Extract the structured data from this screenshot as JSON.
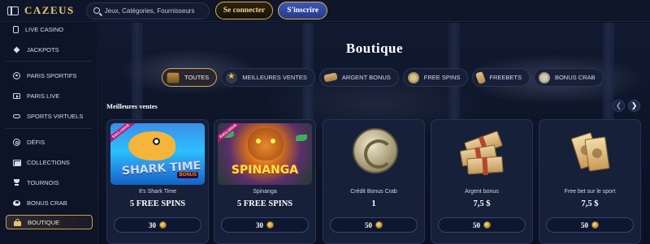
{
  "header": {
    "logo": "CAZEUS",
    "search_placeholder": "Jeux, Catégories, Fournisseurs",
    "login_label": "Se connecter",
    "signup_label": "S'inscrire"
  },
  "sidebar": {
    "items": [
      {
        "label": "LIVE CASINO",
        "icon": "tablet-icon"
      },
      {
        "label": "JACKPOTS",
        "icon": "diamond-icon"
      },
      {
        "label": "PARIS SPORTIFS",
        "icon": "ball-icon"
      },
      {
        "label": "PARIS LIVE",
        "icon": "live-play-icon"
      },
      {
        "label": "SPORTS VIRTUELS",
        "icon": "gamepad-icon"
      },
      {
        "label": "DÉFIS",
        "icon": "target-icon"
      },
      {
        "label": "COLLECTIONS",
        "icon": "layers-icon"
      },
      {
        "label": "TOURNOIS",
        "icon": "trophy-icon"
      },
      {
        "label": "BONUS CRAB",
        "icon": "crab-icon"
      },
      {
        "label": "BOUTIQUE",
        "icon": "shopping-bag-icon",
        "active": true
      }
    ]
  },
  "main": {
    "title": "Boutique",
    "tabs": [
      {
        "label": "TOUTES",
        "icon": "chest-icon",
        "active": true
      },
      {
        "label": "MEILLEURES VENTES",
        "icon": "star-icon"
      },
      {
        "label": "ARGENT BONUS",
        "icon": "banknote-icon"
      },
      {
        "label": "FREE SPINS",
        "icon": "coin-icon"
      },
      {
        "label": "FREEBETS",
        "icon": "ticket-icon"
      },
      {
        "label": "BONUS CRAB",
        "icon": "crab-coin-icon"
      }
    ],
    "section_title": "Meilleures ventes",
    "cards": [
      {
        "name": "It's Shark Time",
        "reward": "5 FREE SPINS",
        "price": "30",
        "art_text": "SHARK TIME",
        "bonus_tag": "BONUS",
        "badge": "EXCLUSIVE"
      },
      {
        "name": "Spinanga",
        "reward": "5 FREE SPINS",
        "price": "30",
        "art_text": "SPINANGA",
        "badge": "EXCLUSIVE"
      },
      {
        "name": "Crédit Bonus Crab",
        "reward": "1",
        "price": "50"
      },
      {
        "name": "Argent bonus",
        "reward": "7,5 $",
        "price": "50"
      },
      {
        "name": "Free bet sur le sport",
        "reward": "7,5 $",
        "price": "50"
      }
    ]
  },
  "colors": {
    "accent_gold": "#d9ad4e",
    "signup_blue": "#3c56b5",
    "background": "#0b1122"
  }
}
